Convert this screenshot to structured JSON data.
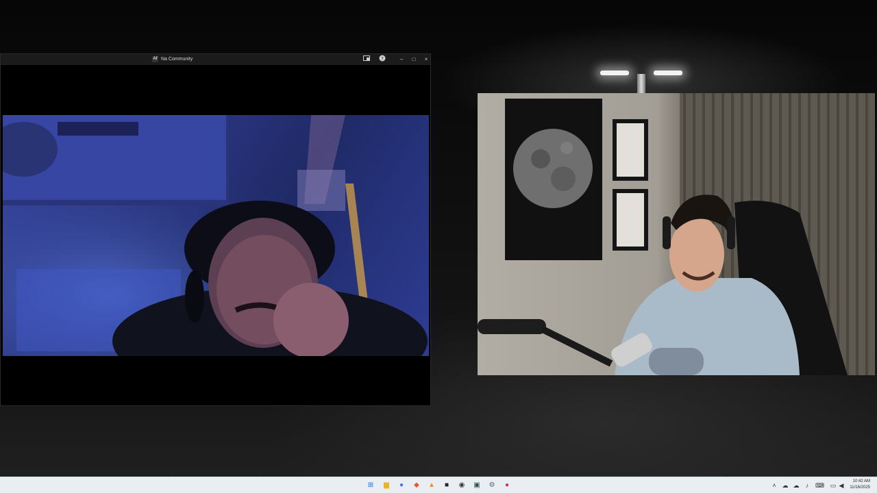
{
  "window": {
    "title": "Na Community",
    "app_icon_label": "Af",
    "controls": {
      "layout_icon": "layout-icon",
      "help_icon": "help-icon",
      "minimize": "–",
      "maximize": "□",
      "close": "×"
    }
  },
  "taskbar": {
    "apps": [
      {
        "name": "start-icon",
        "glyph": "⊞",
        "color": "#1e74d8"
      },
      {
        "name": "file-explorer-icon",
        "glyph": "▆",
        "color": "#e8b528"
      },
      {
        "name": "discord-icon",
        "glyph": "●",
        "color": "#5865f2"
      },
      {
        "name": "brave-icon",
        "glyph": "◆",
        "color": "#f0502c"
      },
      {
        "name": "triangle-app-icon",
        "glyph": "▲",
        "color": "#f28c28"
      },
      {
        "name": "media-app-icon",
        "glyph": "■",
        "color": "#222222"
      },
      {
        "name": "obs-icon",
        "glyph": "◉",
        "color": "#333333"
      },
      {
        "name": "terminal-icon",
        "glyph": "▣",
        "color": "#2f4f4f"
      },
      {
        "name": "settings-icon",
        "glyph": "⚙",
        "color": "#556677"
      },
      {
        "name": "recorder-icon",
        "glyph": "●",
        "color": "#d83333"
      }
    ],
    "tray_icons": [
      "chevron-up-icon",
      "cloud-icon",
      "onedrive-icon",
      "mic-icon",
      "keyboard-icon",
      "network-icon",
      "volume-icon"
    ],
    "time": "10:42 AM",
    "date": "11/16/2025"
  }
}
